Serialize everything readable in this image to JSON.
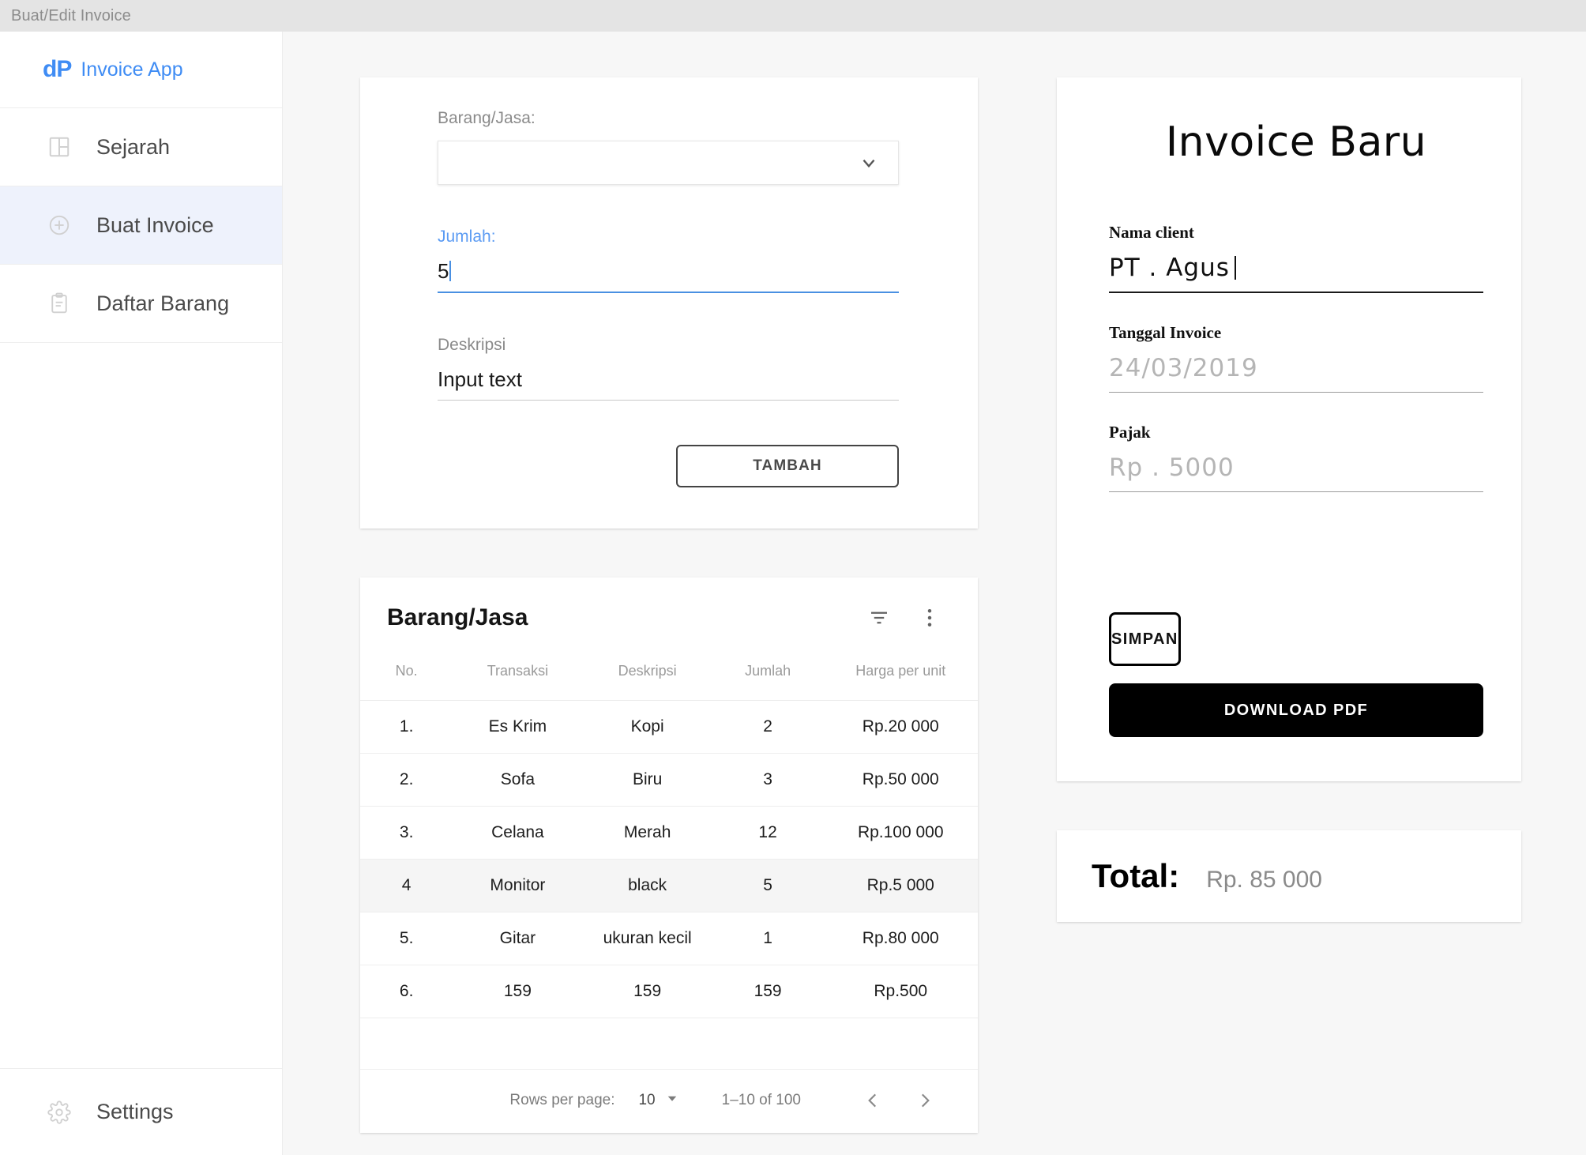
{
  "window": {
    "title": "Buat/Edit Invoice"
  },
  "sidebar": {
    "brand": {
      "logo": "dP",
      "name": "Invoice App"
    },
    "items": [
      {
        "label": "Sejarah",
        "icon": "dashboard-icon",
        "active": false
      },
      {
        "label": "Buat Invoice",
        "icon": "plus-circle-icon",
        "active": true
      },
      {
        "label": "Daftar Barang",
        "icon": "clipboard-icon",
        "active": false
      }
    ],
    "settings": {
      "label": "Settings",
      "icon": "gear-icon"
    }
  },
  "form": {
    "barang_label": "Barang/Jasa:",
    "barang_value": "",
    "jumlah_label": "Jumlah:",
    "jumlah_value": "5",
    "deskripsi_label": "Deskripsi",
    "deskripsi_value": "Input text",
    "submit_label": "TAMBAH"
  },
  "table": {
    "title": "Barang/Jasa",
    "columns": [
      "No.",
      "Transaksi",
      "Deskripsi",
      "Jumlah",
      "Harga per unit"
    ],
    "rows": [
      {
        "no": "1.",
        "transaksi": "Es Krim",
        "deskripsi": "Kopi",
        "jumlah": "2",
        "harga": "Rp.20 000",
        "selected": false
      },
      {
        "no": "2.",
        "transaksi": "Sofa",
        "deskripsi": "Biru",
        "jumlah": "3",
        "harga": "Rp.50 000",
        "selected": false
      },
      {
        "no": "3.",
        "transaksi": "Celana",
        "deskripsi": "Merah",
        "jumlah": "12",
        "harga": "Rp.100 000",
        "selected": false
      },
      {
        "no": "4",
        "transaksi": "Monitor",
        "deskripsi": "black",
        "jumlah": "5",
        "harga": "Rp.5 000",
        "selected": true
      },
      {
        "no": "5.",
        "transaksi": "Gitar",
        "deskripsi": "ukuran kecil",
        "jumlah": "1",
        "harga": "Rp.80 000",
        "selected": false
      },
      {
        "no": "6.",
        "transaksi": "159",
        "deskripsi": "159",
        "jumlah": "159",
        "harga": "Rp.500",
        "selected": false
      }
    ],
    "pagination": {
      "rows_per_page_label": "Rows per page:",
      "rows_per_page_value": "10",
      "range": "1–10 of 100"
    }
  },
  "invoice": {
    "title": "Invoice Baru",
    "nama_client_label": "Nama client",
    "nama_client_value": "PT . Agus",
    "tanggal_label": "Tanggal Invoice",
    "tanggal_placeholder": "24/03/2019",
    "pajak_label": "Pajak",
    "pajak_placeholder": "Rp . 5000",
    "save_label": "SIMPAN",
    "download_label": "DOWNLOAD PDF"
  },
  "total": {
    "label": "Total:",
    "value": "Rp. 85 000"
  },
  "colors": {
    "accent": "#3f8cf4",
    "focus": "#4a90e2",
    "active_nav_bg": "#eef2fc",
    "page_bg": "#f7f7f7",
    "chrome_bg": "#e4e4e4"
  }
}
